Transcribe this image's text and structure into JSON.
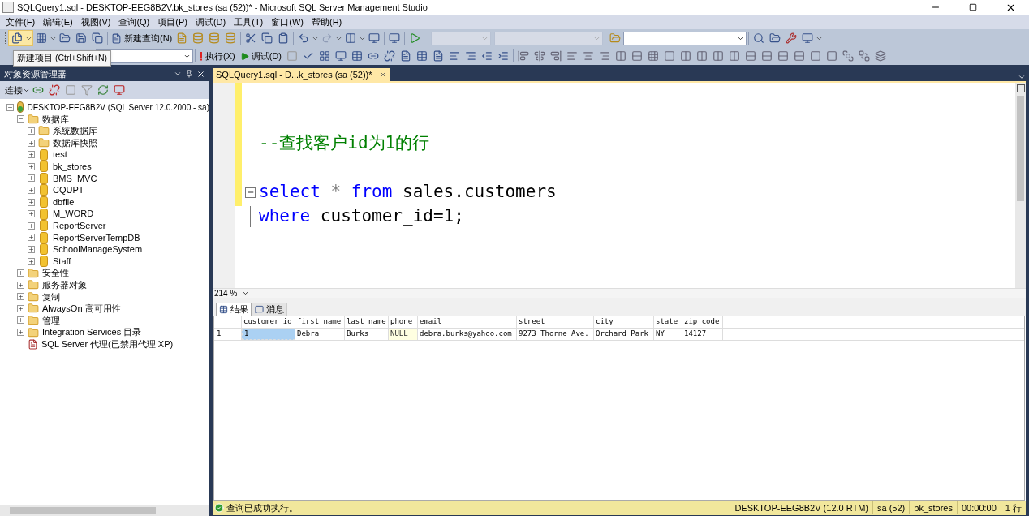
{
  "window": {
    "title": "SQLQuery1.sql - DESKTOP-EEG8B2V.bk_stores (sa (52))* - Microsoft SQL Server Management Studio"
  },
  "menu": [
    "文件(F)",
    "编辑(E)",
    "视图(V)",
    "查询(Q)",
    "项目(P)",
    "调试(D)",
    "工具(T)",
    "窗口(W)",
    "帮助(H)"
  ],
  "toolbar": {
    "new_query": "新建查询(N)",
    "execute": "执行(X)",
    "debug": "调试(D)",
    "tooltip": "新建项目 (Ctrl+Shift+N)"
  },
  "object_explorer": {
    "title": "对象资源管理器",
    "connect": "连接",
    "tree": [
      {
        "label": "DESKTOP-EEG8B2V (SQL Server 12.0.2000 - sa)",
        "kind": "server",
        "expanded": true,
        "children": [
          {
            "label": "数据库",
            "kind": "folder",
            "expanded": true,
            "children": [
              {
                "label": "系统数据库",
                "kind": "folder",
                "expanded": false
              },
              {
                "label": "数据库快照",
                "kind": "folder",
                "expanded": false
              },
              {
                "label": " test",
                "kind": "database",
                "expanded": false
              },
              {
                "label": "bk_stores",
                "kind": "database",
                "expanded": false
              },
              {
                "label": "BMS_MVC",
                "kind": "database",
                "expanded": false
              },
              {
                "label": "CQUPT",
                "kind": "database",
                "expanded": false
              },
              {
                "label": "dbfile",
                "kind": "database",
                "expanded": false
              },
              {
                "label": "M_WORD",
                "kind": "database",
                "expanded": false
              },
              {
                "label": "ReportServer",
                "kind": "database",
                "expanded": false
              },
              {
                "label": "ReportServerTempDB",
                "kind": "database",
                "expanded": false
              },
              {
                "label": "SchoolManageSystem",
                "kind": "database",
                "expanded": false
              },
              {
                "label": "Staff",
                "kind": "database",
                "expanded": false
              }
            ]
          },
          {
            "label": "安全性",
            "kind": "folder",
            "expanded": false
          },
          {
            "label": "服务器对象",
            "kind": "folder",
            "expanded": false
          },
          {
            "label": "复制",
            "kind": "folder",
            "expanded": false
          },
          {
            "label": "AlwaysOn 高可用性",
            "kind": "folder",
            "expanded": false
          },
          {
            "label": "管理",
            "kind": "folder",
            "expanded": false
          },
          {
            "label": "Integration Services 目录",
            "kind": "folder",
            "expanded": false
          },
          {
            "label": "SQL Server 代理(已禁用代理 XP)",
            "kind": "agent"
          }
        ]
      }
    ]
  },
  "editor": {
    "tab": {
      "title": "SQLQuery1.sql - D...k_stores (sa (52))*",
      "selected": true
    },
    "lines": [
      {
        "kind": "blank"
      },
      {
        "kind": "code",
        "tokens": [
          {
            "text": "--查找客户id为1的行",
            "kind": "comment"
          }
        ]
      },
      {
        "kind": "blank"
      },
      {
        "kind": "code",
        "folded": false,
        "tokens": [
          {
            "text": "select",
            "kind": "keyword"
          },
          {
            "text": " * ",
            "kind": "operator"
          },
          {
            "text": "from",
            "kind": "keyword"
          },
          {
            "text": " sales.customers",
            "kind": "plain"
          }
        ]
      },
      {
        "kind": "code",
        "in_block": true,
        "tokens": [
          {
            "text": "where",
            "kind": "keyword"
          },
          {
            "text": " customer_id=1;",
            "kind": "plain"
          }
        ]
      }
    ],
    "zoom": "214 %"
  },
  "results": {
    "tabs": [
      {
        "label": "结果",
        "kind": "grid",
        "selected": true
      },
      {
        "label": "消息",
        "kind": "messages",
        "selected": false
      }
    ],
    "columns": [
      "customer_id",
      "first_name",
      "last_name",
      "phone",
      "email",
      "street",
      "city",
      "state",
      "zip_code"
    ],
    "rows": [
      {
        "number": "1",
        "cells": [
          {
            "text": "1",
            "kind": "value",
            "selected": true
          },
          {
            "text": "Debra",
            "kind": "value",
            "selected": false
          },
          {
            "text": "Burks",
            "kind": "value",
            "selected": false
          },
          {
            "text": "NULL",
            "kind": "null",
            "selected": false
          },
          {
            "text": "debra.burks@yahoo.com",
            "kind": "value",
            "selected": false
          },
          {
            "text": "9273 Thorne Ave.",
            "kind": "value",
            "selected": false
          },
          {
            "text": "Orchard Park",
            "kind": "value",
            "selected": false
          },
          {
            "text": "NY",
            "kind": "value",
            "selected": false
          },
          {
            "text": "14127",
            "kind": "value",
            "selected": false
          }
        ]
      }
    ]
  },
  "status_bar": {
    "message": "查询已成功执行。",
    "fields": [
      "DESKTOP-EEG8B2V (12.0 RTM)",
      "sa (52)",
      "bk_stores",
      "00:00:00",
      "1 行"
    ]
  }
}
